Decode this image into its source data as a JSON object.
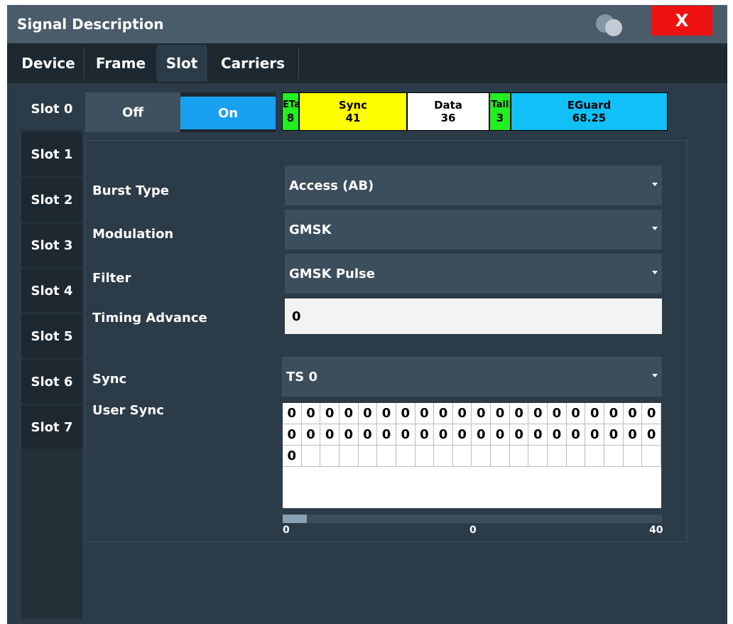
{
  "window": {
    "title": "Signal Description",
    "close_label": "X"
  },
  "tabs": [
    "Device",
    "Frame",
    "Slot",
    "Carriers"
  ],
  "active_tab": "Slot",
  "slots": [
    "Slot 0",
    "Slot 1",
    "Slot 2",
    "Slot 3",
    "Slot 4",
    "Slot 5",
    "Slot 6",
    "Slot 7"
  ],
  "active_slot": "Slot 0",
  "toggle": {
    "off_label": "Off",
    "on_label": "On",
    "state": "On"
  },
  "burst": [
    {
      "name": "ETail",
      "value": "8",
      "color": "#22ee22"
    },
    {
      "name": "Sync",
      "value": "41",
      "color": "#ffff00"
    },
    {
      "name": "Data",
      "value": "36",
      "color": "#ffffff"
    },
    {
      "name": "Tail",
      "value": "3",
      "color": "#22ee22"
    },
    {
      "name": "EGuard",
      "value": "68.25",
      "color": "#11c0f6"
    }
  ],
  "fields": {
    "burst_type": {
      "label": "Burst Type",
      "value": "Access (AB)"
    },
    "modulation": {
      "label": "Modulation",
      "value": "GMSK"
    },
    "filter": {
      "label": "Filter",
      "value": "GMSK Pulse"
    },
    "timing_advance": {
      "label": "Timing Advance",
      "value": "0"
    },
    "sync": {
      "label": "Sync",
      "value": "TS 0"
    },
    "user_sync": {
      "label": "User Sync"
    }
  },
  "user_sync_bits": [
    "0",
    "0",
    "0",
    "0",
    "0",
    "0",
    "0",
    "0",
    "0",
    "0",
    "0",
    "0",
    "0",
    "0",
    "0",
    "0",
    "0",
    "0",
    "0",
    "0",
    "0",
    "0",
    "0",
    "0",
    "0",
    "0",
    "0",
    "0",
    "0",
    "0",
    "0",
    "0",
    "0",
    "0",
    "0",
    "0",
    "0",
    "0",
    "0",
    "0",
    "0"
  ],
  "scrollbar": {
    "min_label": "0",
    "mid_label": "0",
    "max_label": "40",
    "position_fraction": 0.0
  },
  "colors": {
    "accent": "#1aa0f0",
    "close": "#ee1111",
    "background": "#2c3b48"
  },
  "icons": {
    "help": "help-bubbles-icon",
    "close": "close-icon",
    "dropdown": "chevron-down-icon"
  }
}
